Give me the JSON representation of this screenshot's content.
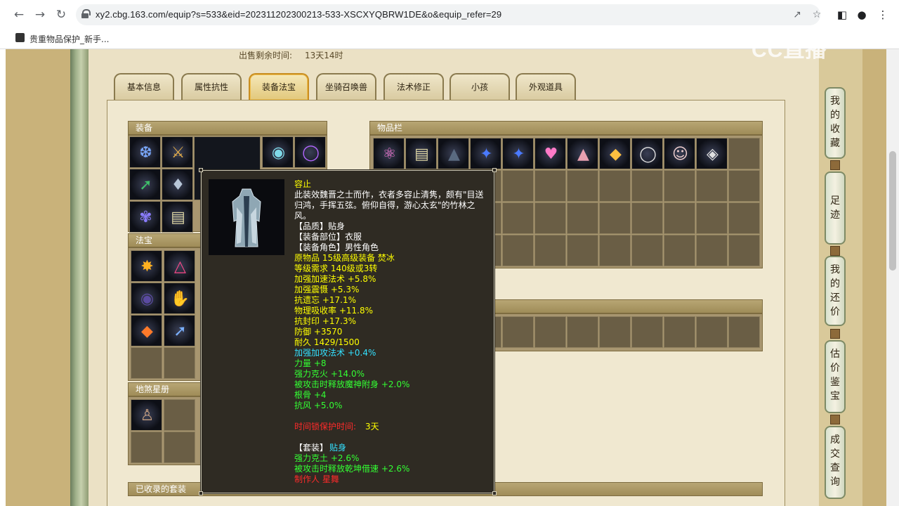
{
  "browser": {
    "url": "xy2.cbg.163.com/equip?s=533&eid=202311202300213-533-XSCXYQBRW1DE&o&equip_refer=29",
    "bookmark": "贵重物品保护_新手..."
  },
  "watermark": "CC直播",
  "sale": {
    "label": "出售剩余时间:",
    "value": "13天14时"
  },
  "tabs": [
    "基本信息",
    "属性抗性",
    "装备法宝",
    "坐骑召唤兽",
    "法术修正",
    "小孩",
    "外观道具"
  ],
  "active_tab": 2,
  "sections": {
    "equipment": "装备",
    "inventory": "物品栏",
    "fabao": "法宝",
    "stars": "地煞星册",
    "collected_sets": "已收录的套装"
  },
  "tooltip": {
    "name": "容止",
    "desc": [
      "此装效魏晋之士而作，衣者多容止清隽，颇有\"目送",
      "归鸿，手挥五弦。俯仰自得，游心太玄\"的竹林之",
      "风。"
    ],
    "quality": "【品质】贴身",
    "slot": "【装备部位】衣服",
    "role": "【装备角色】男性角色",
    "origin": "原物品 15级高级装备 焚冰",
    "level_req": "等级需求 140级或3转",
    "stats_yellow": [
      "加强加速法术 +5.8%",
      "加强震慑 +5.3%",
      "抗遗忘 +17.1%",
      "物理吸收率 +11.8%",
      "抗封印 +17.3%",
      "防御 +3570",
      "耐久 1429/1500"
    ],
    "stat_cyan": "加强加攻法术 +0.4%",
    "stats_green": [
      "力量 +8",
      "强力克火 +14.0%",
      "被攻击时释放魔神附身 +2.0%",
      "根骨 +4",
      "抗风 +5.0%"
    ],
    "protect_label": "时间锁保护时间:",
    "protect_value": "3天",
    "set_label": "【套装】",
    "set_value": "贴身",
    "set_stats": [
      "强力克土 +2.6%",
      "被攻击时释放乾坤借速 +2.6%"
    ],
    "maker": "制作人 星舞"
  },
  "side_nav": [
    "我的收藏",
    "足迹",
    "我的还价",
    "估价鉴宝",
    "成交查询"
  ]
}
